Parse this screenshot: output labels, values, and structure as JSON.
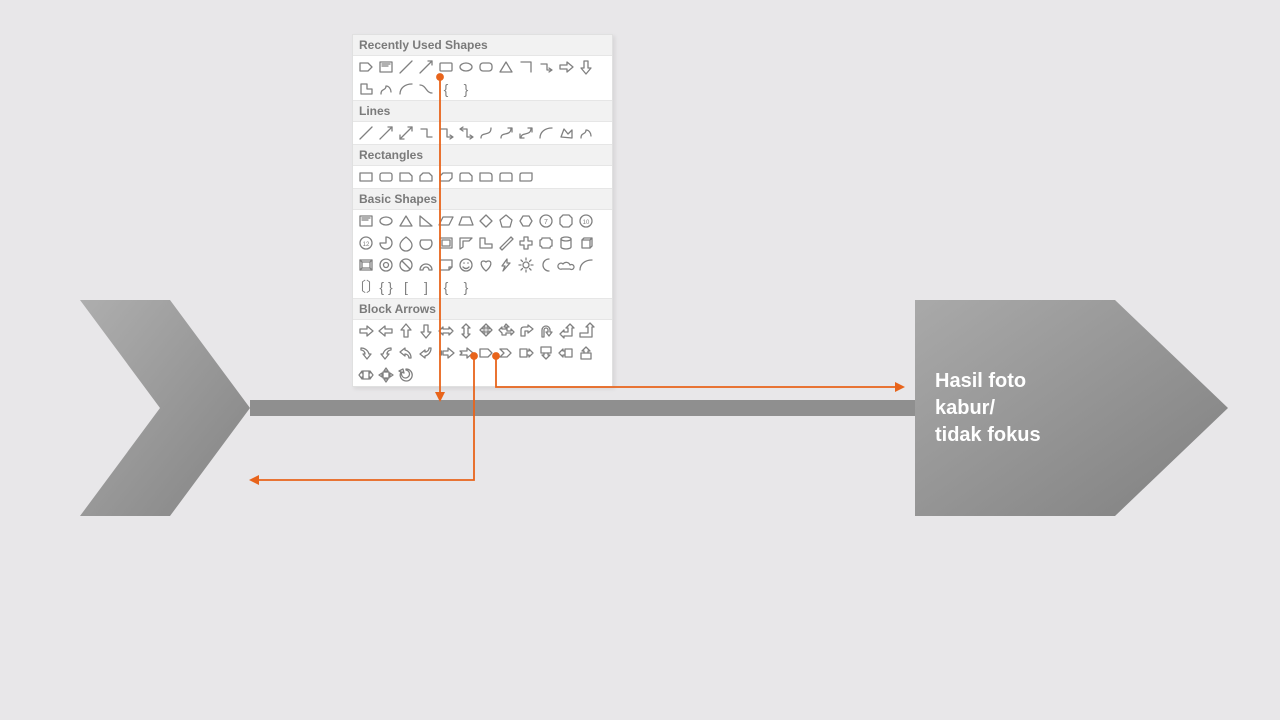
{
  "panel": {
    "sections": {
      "recent": "Recently Used Shapes",
      "lines": "Lines",
      "rects": "Rectangles",
      "basic": "Basic Shapes",
      "block": "Block Arrows"
    }
  },
  "arrow_head_text": "Hasil foto\nkabur/\ntidak fokus",
  "colors": {
    "panel_bg": "#ffffff",
    "section_bg": "#f2f2f2",
    "shape_stroke": "#808080",
    "body_bg": "#e8e7e9",
    "callout": "#e8641b",
    "arrow_dark": "#888688",
    "arrow_light": "#aeadae"
  }
}
